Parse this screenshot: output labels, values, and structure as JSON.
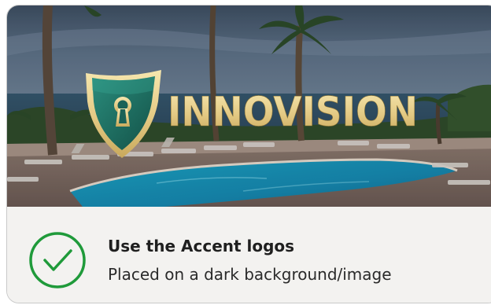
{
  "logo": {
    "wordmark": "INNOVISION",
    "emblem_icon": "shield-keyhole-icon"
  },
  "caption": {
    "status_icon": "check-circle-icon",
    "title": "Use the Accent logos",
    "subtitle": "Placed on a dark background/image"
  },
  "colors": {
    "accent_green": "#1f9a3a",
    "shield_teal": "#1d6b62",
    "gold": "#e6cf8a",
    "caption_bg": "#f3f2f0"
  }
}
